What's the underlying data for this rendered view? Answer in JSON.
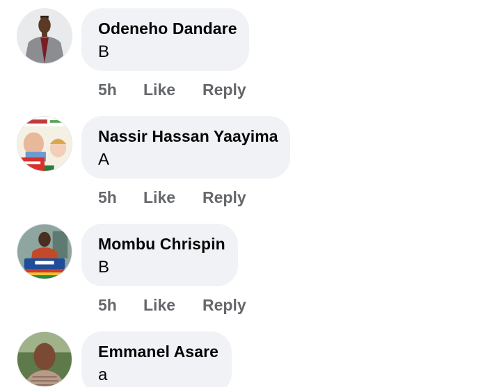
{
  "comments": [
    {
      "author": "Odeneho Dandare",
      "text": "B",
      "time": "5h",
      "like_label": "Like",
      "reply_label": "Reply",
      "avatar_icon": "profile-photo"
    },
    {
      "author": "Nassir Hassan Yaayima",
      "text": "A",
      "time": "5h",
      "like_label": "Like",
      "reply_label": "Reply",
      "avatar_icon": "profile-photo"
    },
    {
      "author": "Mombu Chrispin",
      "text": "B",
      "time": "5h",
      "like_label": "Like",
      "reply_label": "Reply",
      "avatar_icon": "profile-photo"
    },
    {
      "author": "Emmanel Asare",
      "text": "a",
      "avatar_icon": "profile-photo"
    }
  ],
  "colors": {
    "bubble": "#f0f2f5",
    "author_text": "#050505",
    "action_text": "#65676b"
  }
}
